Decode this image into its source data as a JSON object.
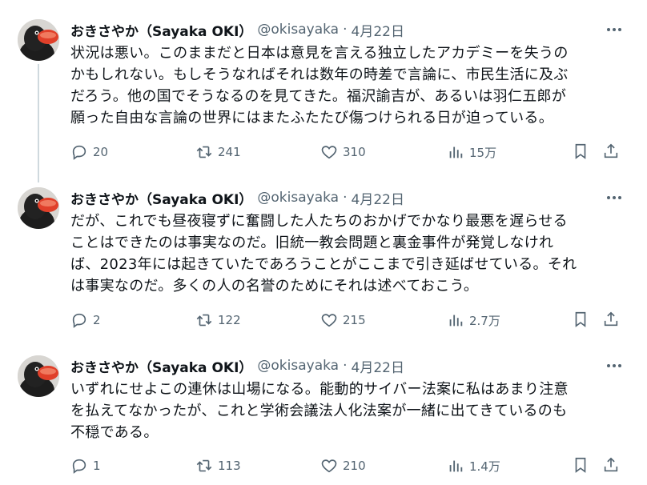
{
  "tweets": [
    {
      "name": "おきさやか（Sayaka OKI）",
      "handle": "@okisayaka",
      "dot": "·",
      "date": "4月22日",
      "lines": [
        "状況は悪い。このままだと日本は意見を言える独立したアカデミーを失うの",
        "かもしれない。もしそうなればそれは数年の時差で言論に、市民生活に及ぶ",
        "だろう。他の国でそうなるのを見てきた。福沢諭吉が、あるいは羽仁五郎が",
        "願った自由な言論の世界にはまたふたたび傷つけられる日が迫っている。"
      ],
      "replies": "20",
      "retweets": "241",
      "likes": "310",
      "views": "15万"
    },
    {
      "name": "おきさやか（Sayaka OKI）",
      "handle": "@okisayaka",
      "dot": "·",
      "date": "4月22日",
      "lines": [
        "だが、これでも昼夜寝ずに奮闘した人たちのおかげでかなり最悪を遅らせる",
        "ことはできたのは事実なのだ。旧統一教会問題と裏金事件が発覚しなけれ",
        "ば、2023年には起きていたであろうことがここまで引き延ばせている。それ",
        "は事実なのだ。多くの人の名誉のためにそれは述べておこう。"
      ],
      "replies": "2",
      "retweets": "122",
      "likes": "215",
      "views": "2.7万"
    },
    {
      "name": "おきさやか（Sayaka OKI）",
      "handle": "@okisayaka",
      "dot": "·",
      "date": "4月22日",
      "lines": [
        "いずれにせよこの連休は山場になる。能動的サイバー法案に私はあまり注意",
        "を払えてなかったが、これと学術会議法人化法案が一緒に出てきているのも",
        "不穏である。"
      ],
      "replies": "1",
      "retweets": "113",
      "likes": "210",
      "views": "1.4万"
    }
  ],
  "icons": {
    "reply": "reply-icon",
    "retweet": "retweet-icon",
    "like": "like-icon",
    "views": "views-icon",
    "bookmark": "bookmark-icon",
    "share": "share-icon",
    "more": "more-icon"
  },
  "colors": {
    "text": "#0f1419",
    "secondary": "#536471",
    "thread_line": "#cfd9de"
  }
}
